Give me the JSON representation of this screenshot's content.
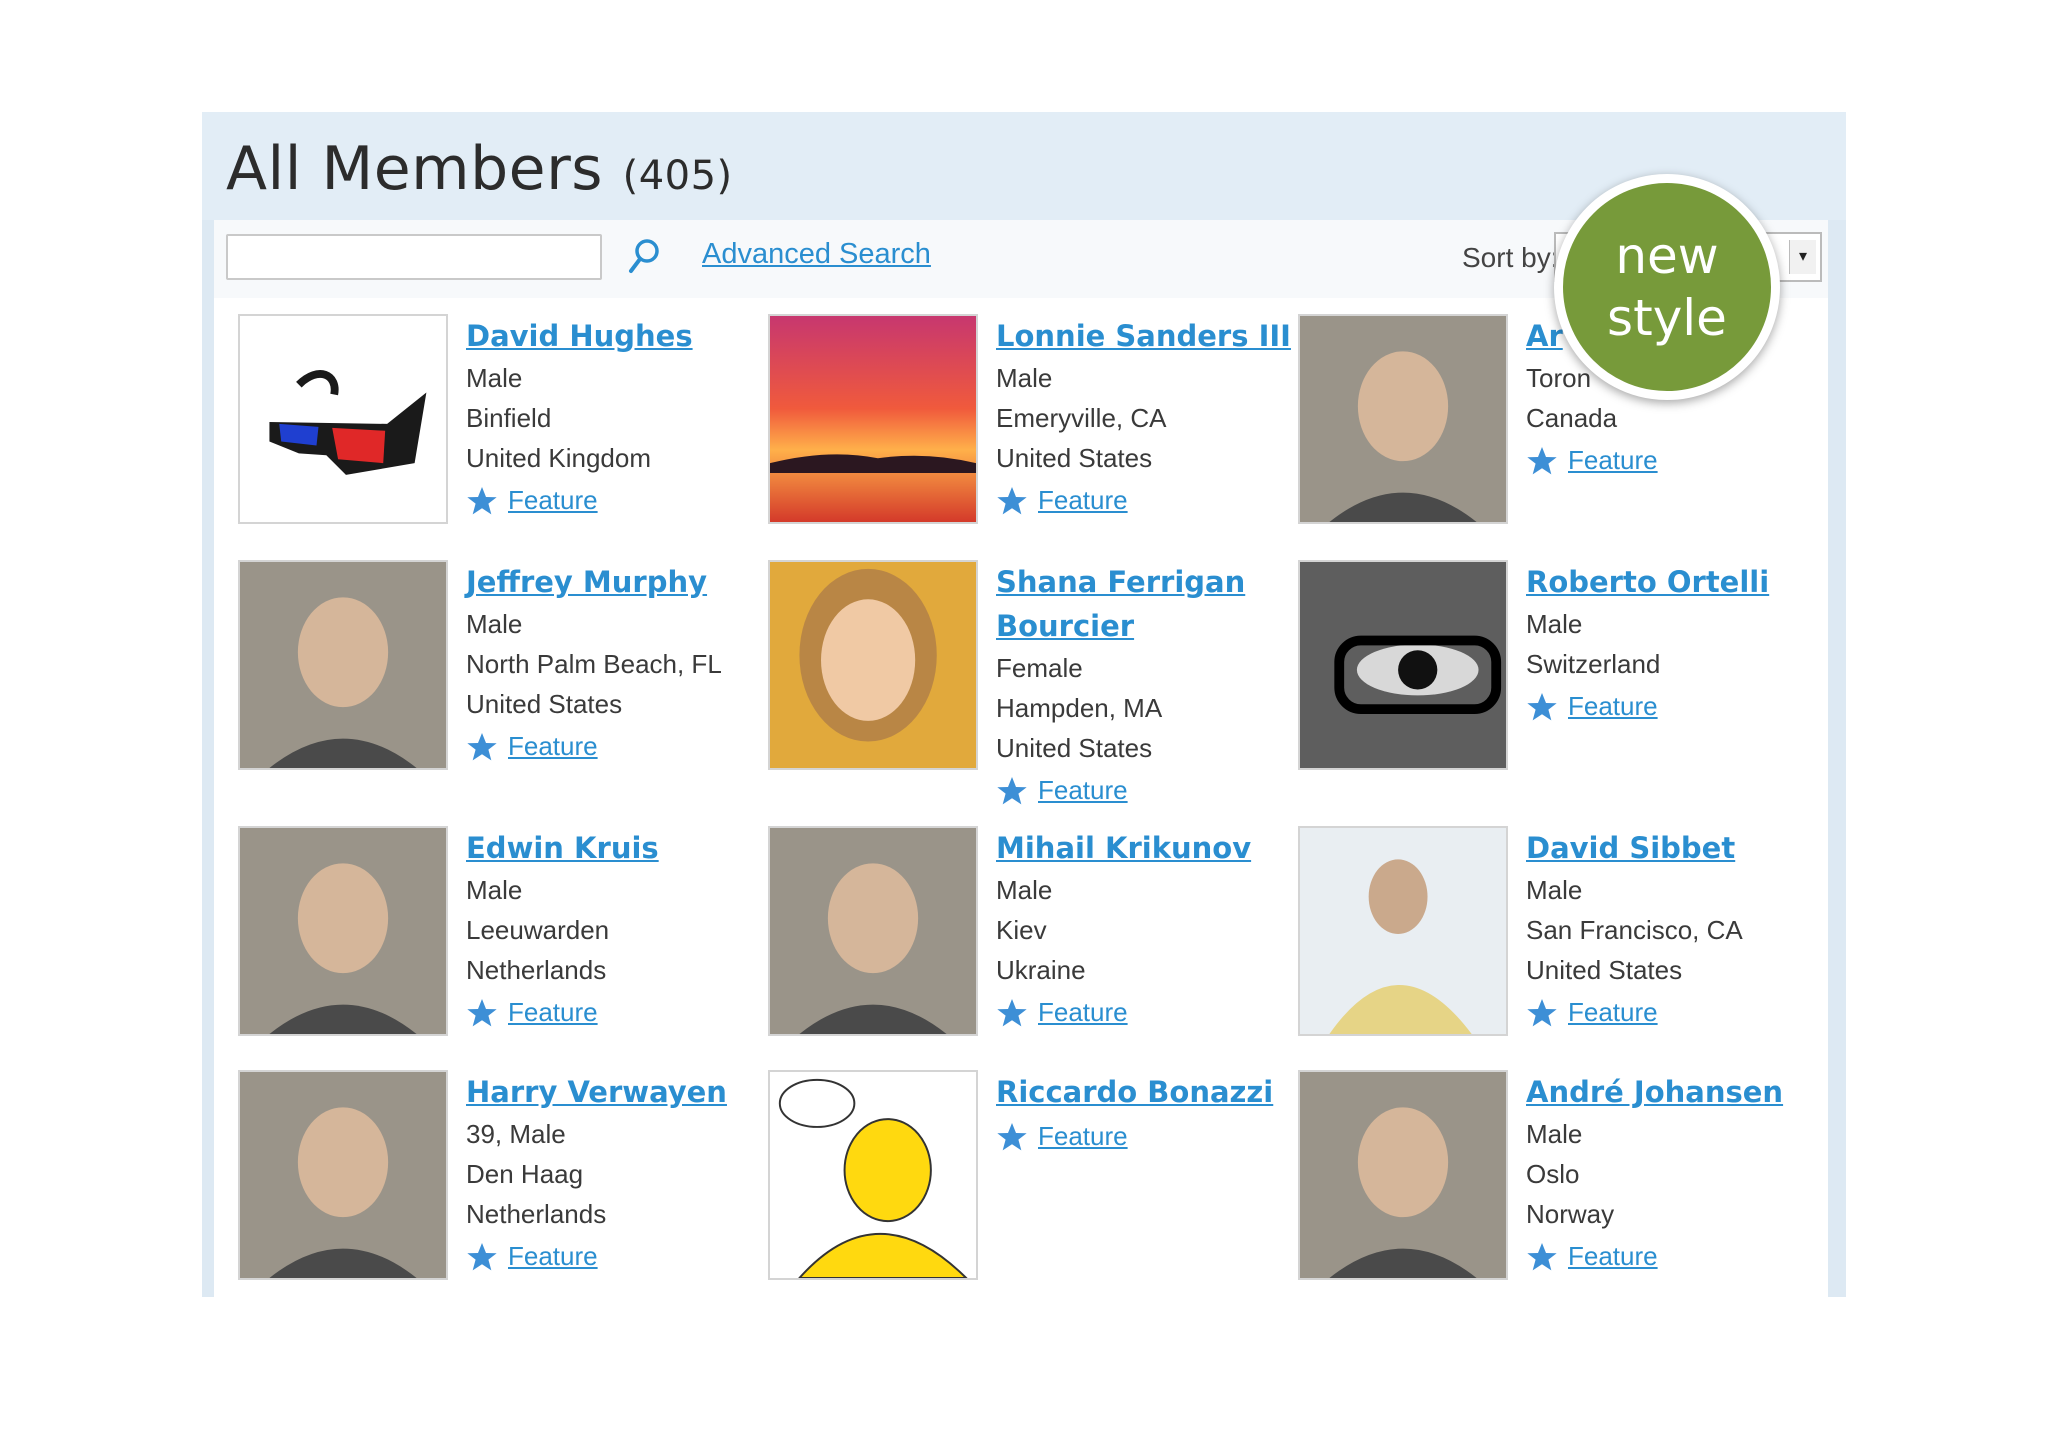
{
  "page": {
    "title": "All Members",
    "count": "(405)"
  },
  "toolbar": {
    "search_value": "",
    "advanced_search_label": "Advanced Search",
    "sort_label": "Sort by:",
    "sort_value": ""
  },
  "badge": {
    "line1": "new",
    "line2": "style",
    "color": "#779a3a"
  },
  "colors": {
    "link": "#2a8ed0",
    "panel": "#dde9f3",
    "star": "#3d8fd6"
  },
  "feature_label": "Feature",
  "members": [
    {
      "name": "David Hughes",
      "lines": [
        "Male",
        "Binfield",
        "United Kingdom"
      ],
      "photo": "3d-glasses-icon"
    },
    {
      "name": "Lonnie Sanders III",
      "lines": [
        "Male",
        "Emeryville, CA",
        "United States"
      ],
      "photo": "sunset-photo"
    },
    {
      "name": "Ar",
      "lines": [
        "Toron",
        "Canada"
      ],
      "photo": "man-portrait-photo"
    },
    {
      "name": "Jeffrey Murphy",
      "lines": [
        "Male",
        "North Palm Beach, FL",
        "United States"
      ],
      "photo": "man-portrait-photo"
    },
    {
      "name": "Shana Ferrigan Bourcier",
      "lines": [
        "Female",
        "Hampden, MA",
        "United States"
      ],
      "photo": "woman-portrait-photo"
    },
    {
      "name": "Roberto Ortelli",
      "lines": [
        "Male",
        "Switzerland"
      ],
      "photo": "eye-closeup-photo"
    },
    {
      "name": "Edwin Kruis",
      "lines": [
        "Male",
        "Leeuwarden",
        "Netherlands"
      ],
      "photo": "man-portrait-photo"
    },
    {
      "name": "Mihail Krikunov",
      "lines": [
        "Male",
        "Kiev",
        "Ukraine"
      ],
      "photo": "man-portrait-photo"
    },
    {
      "name": "David Sibbet",
      "lines": [
        "Male",
        "San Francisco, CA",
        "United States"
      ],
      "photo": "man-speaking-photo"
    },
    {
      "name": "Harry Verwayen",
      "lines": [
        "39, Male",
        "Den Haag",
        "Netherlands"
      ],
      "photo": "man-portrait-photo"
    },
    {
      "name": "Riccardo Bonazzi",
      "lines": [],
      "photo": "cartoon-character-image"
    },
    {
      "name": "André Johansen",
      "lines": [
        "Male",
        "Oslo",
        "Norway"
      ],
      "photo": "man-portrait-photo"
    }
  ]
}
